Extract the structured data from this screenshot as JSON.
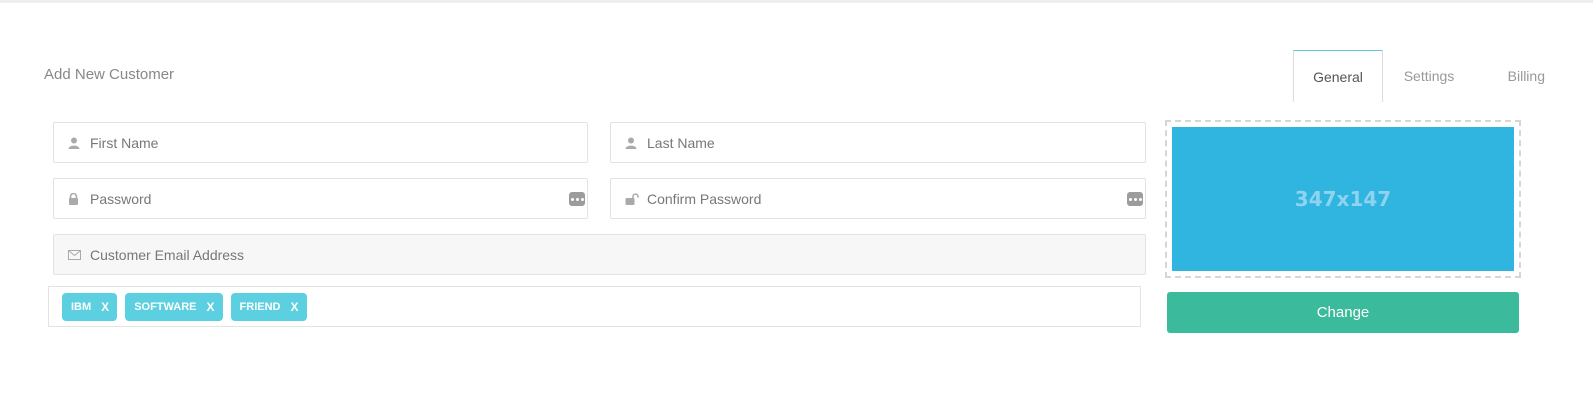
{
  "panel": {
    "title": "Add New Customer"
  },
  "tabs": [
    {
      "label": "General",
      "active": true
    },
    {
      "label": "Settings",
      "active": false
    },
    {
      "label": "Billing",
      "active": false
    }
  ],
  "form": {
    "first_name": {
      "placeholder": "First Name",
      "icon": "user-icon"
    },
    "last_name": {
      "placeholder": "Last Name",
      "icon": "user-icon"
    },
    "password": {
      "placeholder": "Password",
      "icon": "lock-icon"
    },
    "confirm_password": {
      "placeholder": "Confirm Password",
      "icon": "unlock-icon"
    },
    "email": {
      "placeholder": "Customer Email Address",
      "icon": "envelope-icon"
    }
  },
  "tags": [
    {
      "label": "IBM",
      "remove": "X"
    },
    {
      "label": "SOFTWARE",
      "remove": "X"
    },
    {
      "label": "FRIEND",
      "remove": "X"
    }
  ],
  "image": {
    "placeholder_text": "347x147"
  },
  "change_button": {
    "label": "Change"
  },
  "colors": {
    "tag": "#5cd0e0",
    "image_placeholder": "#30b4e0",
    "change_button": "#3bbb9b",
    "active_tab_top": "#63c5dc"
  }
}
